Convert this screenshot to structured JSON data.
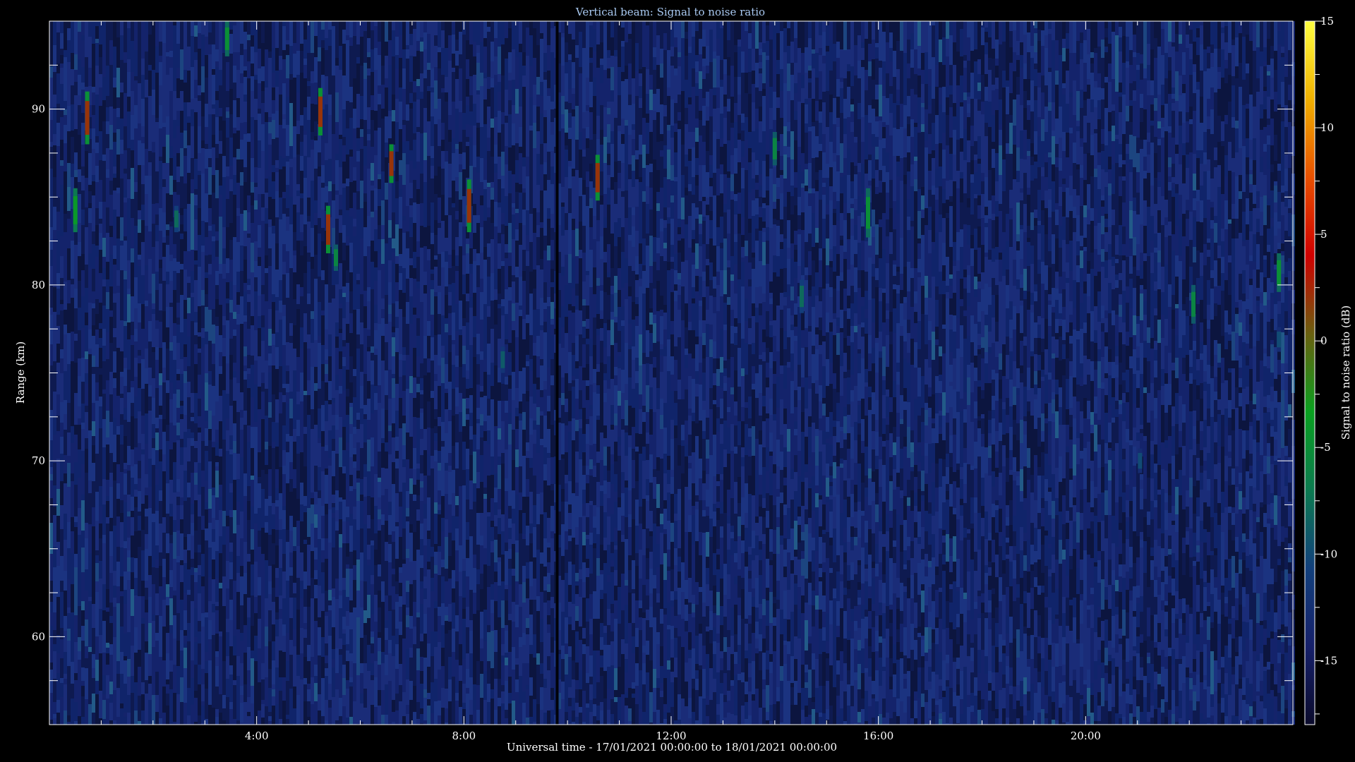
{
  "chart_data": {
    "type": "heatmap",
    "title": "Vertical beam: Signal to noise ratio",
    "xlabel": "Universal time - 17/01/2021 00:00:00 to 18/01/2021 00:00:00",
    "ylabel": "Range (km)",
    "colorbar_label": "Signal to noise ratio (dB)",
    "x_unit": "hours UT",
    "xlim": [
      0,
      24
    ],
    "ylim": [
      55,
      95
    ],
    "clim": [
      -18,
      15
    ],
    "x_ticks": [
      {
        "value": 4,
        "label": "4:00"
      },
      {
        "value": 8,
        "label": "8:00"
      },
      {
        "value": 12,
        "label": "12:00"
      },
      {
        "value": 16,
        "label": "16:00"
      },
      {
        "value": 20,
        "label": "20:00"
      }
    ],
    "y_ticks": [
      {
        "value": 60,
        "label": "60"
      },
      {
        "value": 70,
        "label": "70"
      },
      {
        "value": 80,
        "label": "80"
      },
      {
        "value": 90,
        "label": "90"
      }
    ],
    "colorbar_ticks": [
      {
        "value": 15,
        "label": "15"
      },
      {
        "value": 10,
        "label": "10"
      },
      {
        "value": 5,
        "label": "5"
      },
      {
        "value": 0,
        "label": "0"
      },
      {
        "value": -5,
        "label": "-5"
      },
      {
        "value": -10,
        "label": "-10"
      },
      {
        "value": -15,
        "label": "-15"
      }
    ],
    "background_snr_db": -16,
    "data_gap_hours": 9.8,
    "echoes": [
      {
        "time": 0.5,
        "range_low": 83,
        "range_high": 85.5,
        "snr": -4
      },
      {
        "time": 0.73,
        "range_low": 88,
        "range_high": 91,
        "snr": 2
      },
      {
        "time": 2.45,
        "range_low": 83,
        "range_high": 84.5,
        "snr": -8
      },
      {
        "time": 3.43,
        "range_low": 93,
        "range_high": 95,
        "snr": -5
      },
      {
        "time": 5.23,
        "range_low": 88.5,
        "range_high": 91.2,
        "snr": 2
      },
      {
        "time": 5.38,
        "range_low": 81.8,
        "range_high": 84.5,
        "snr": 2
      },
      {
        "time": 5.53,
        "range_low": 80.8,
        "range_high": 82.3,
        "snr": -6
      },
      {
        "time": 6.6,
        "range_low": 85.8,
        "range_high": 88,
        "snr": 2
      },
      {
        "time": 8.1,
        "range_low": 83,
        "range_high": 86,
        "snr": 2
      },
      {
        "time": 8.75,
        "range_low": 75,
        "range_high": 76.5,
        "snr": -9
      },
      {
        "time": 10.58,
        "range_low": 84.8,
        "range_high": 87.4,
        "snr": 2
      },
      {
        "time": 14.0,
        "range_low": 86.8,
        "range_high": 88.7,
        "snr": -6
      },
      {
        "time": 14.52,
        "range_low": 78.4,
        "range_high": 80.3,
        "snr": -8
      },
      {
        "time": 15.8,
        "range_low": 82.7,
        "range_high": 85.5,
        "snr": -5
      },
      {
        "time": 21.05,
        "range_low": 69.3,
        "range_high": 70.7,
        "snr": -10
      },
      {
        "time": 22.08,
        "range_low": 77.8,
        "range_high": 80,
        "snr": -6
      },
      {
        "time": 23.73,
        "range_low": 79.6,
        "range_high": 81.8,
        "snr": -5
      },
      {
        "time": 23.73,
        "range_low": 76.2,
        "range_high": 77.6,
        "snr": -10
      }
    ],
    "colors": {
      "background": "#000000",
      "frame": "#ffffff",
      "title": "#a8c8f0",
      "colormap": [
        "#0b0b2c",
        "#16206a",
        "#12407c",
        "#0c7a50",
        "#0aa020",
        "#6a6010",
        "#d00000",
        "#e85000",
        "#f0b000",
        "#ffff40"
      ]
    }
  }
}
